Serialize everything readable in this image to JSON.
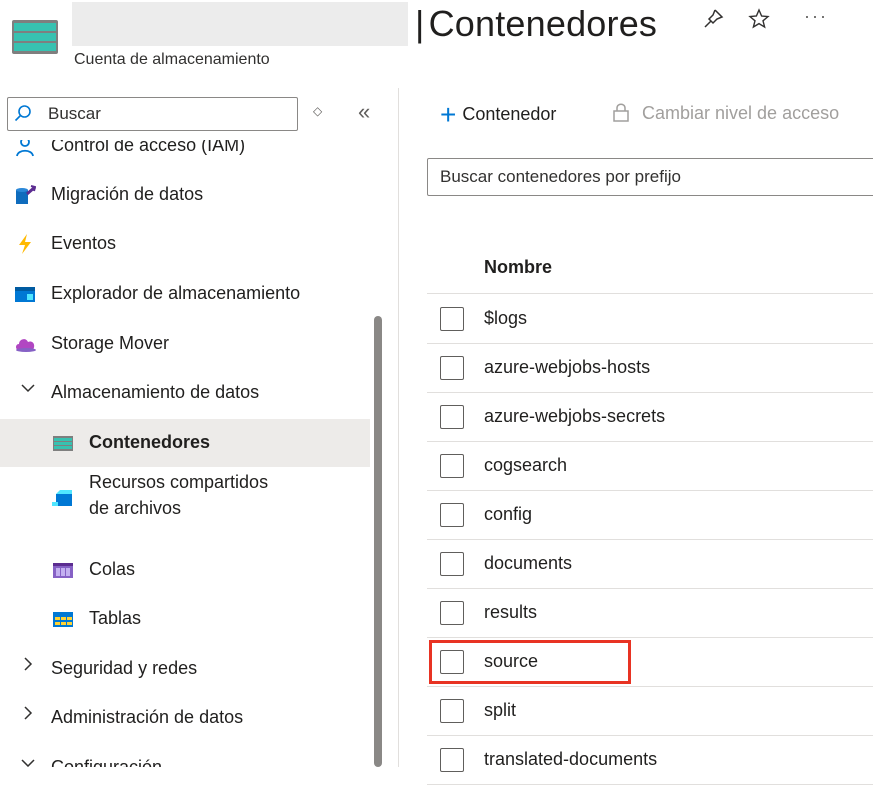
{
  "header": {
    "title": "Contenedores",
    "title_separator": "|",
    "subtitle": "Cuenta de almacenamiento",
    "pin_icon": "pin-icon",
    "favorite_icon": "star-icon",
    "more_label": "···"
  },
  "sidebar": {
    "search_placeholder": "Buscar",
    "sort_glyph": "◇",
    "collapse_glyph": "«",
    "items": [
      {
        "label": "Control de acceso (IAM)",
        "icon": "people-icon"
      },
      {
        "label": "Migración de datos",
        "icon": "data-migration-icon"
      },
      {
        "label": "Eventos",
        "icon": "lightning-icon"
      },
      {
        "label": "Explorador de almacenamiento",
        "icon": "storage-explorer-icon"
      },
      {
        "label": "Storage Mover",
        "icon": "cloud-icon"
      },
      {
        "label": "Almacenamiento de datos",
        "icon": "chevron-down-icon",
        "expanded": true
      },
      {
        "label": "Contenedores",
        "icon": "container-icon",
        "selected": true
      },
      {
        "label_line1": "Recursos compartidos",
        "label_line2": "de archivos",
        "icon": "file-share-icon"
      },
      {
        "label": "Colas",
        "icon": "queue-icon"
      },
      {
        "label": "Tablas",
        "icon": "table-icon"
      },
      {
        "label": "Seguridad y redes",
        "icon": "chevron-right-icon"
      },
      {
        "label": "Administración de datos",
        "icon": "chevron-right-icon"
      },
      {
        "label": "Configuración",
        "icon": "chevron-down-icon"
      }
    ]
  },
  "toolbar": {
    "add_label": "Contenedor",
    "access_label": "Cambiar nivel de acceso"
  },
  "filter": {
    "placeholder": "Buscar contenedores por prefijo"
  },
  "table": {
    "column_header": "Nombre",
    "rows": [
      "$logs",
      "azure-webjobs-hosts",
      "azure-webjobs-secrets",
      "cogsearch",
      "config",
      "documents",
      "results",
      "source",
      "split",
      "translated-documents"
    ],
    "highlighted_row": "source"
  },
  "colors": {
    "accent": "#0078d4",
    "highlight_box": "#e83323",
    "selected_bg": "#edebe9"
  }
}
